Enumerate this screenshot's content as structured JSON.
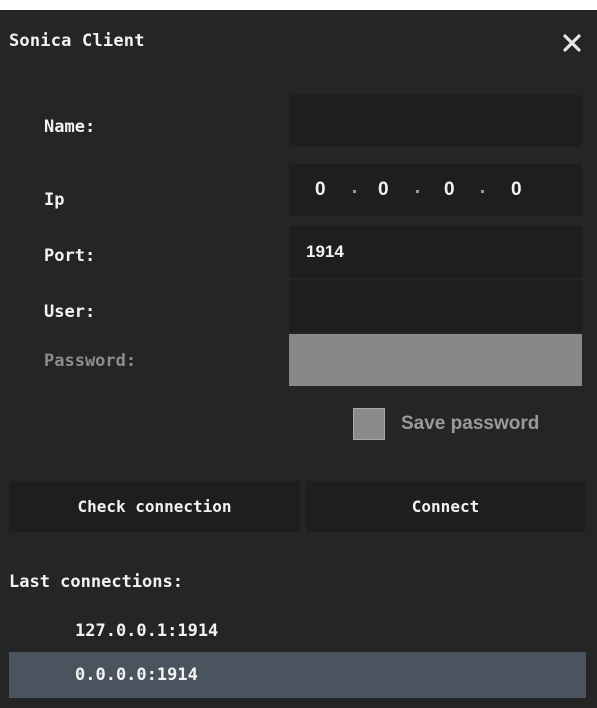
{
  "window": {
    "title": "Sonica Client",
    "close_icon": "close-icon"
  },
  "form": {
    "name_label": "Name:",
    "name_value": "",
    "ip_label": "Ip",
    "ip_octets": [
      "0",
      "0",
      "0",
      "0"
    ],
    "port_label": "Port:",
    "port_value": "1914",
    "user_label": "User:",
    "user_value": "",
    "password_label": "Password:",
    "password_value": "",
    "password_enabled": false,
    "save_password_label": "Save password",
    "save_password_checked": false
  },
  "actions": {
    "check_label": "Check connection",
    "connect_label": "Connect"
  },
  "last_connections": {
    "title": "Last connections:",
    "items": [
      {
        "address": "127.0.0.1:1914",
        "selected": false
      },
      {
        "address": "0.0.0.0:1914",
        "selected": true
      }
    ]
  },
  "colors": {
    "window_bg": "#252526",
    "field_bg": "#1e1e1e",
    "disabled_field_bg": "#888888",
    "selected_row_bg": "#4a545e",
    "text": "#f2f2f2",
    "disabled_text": "#8c8c8c"
  }
}
